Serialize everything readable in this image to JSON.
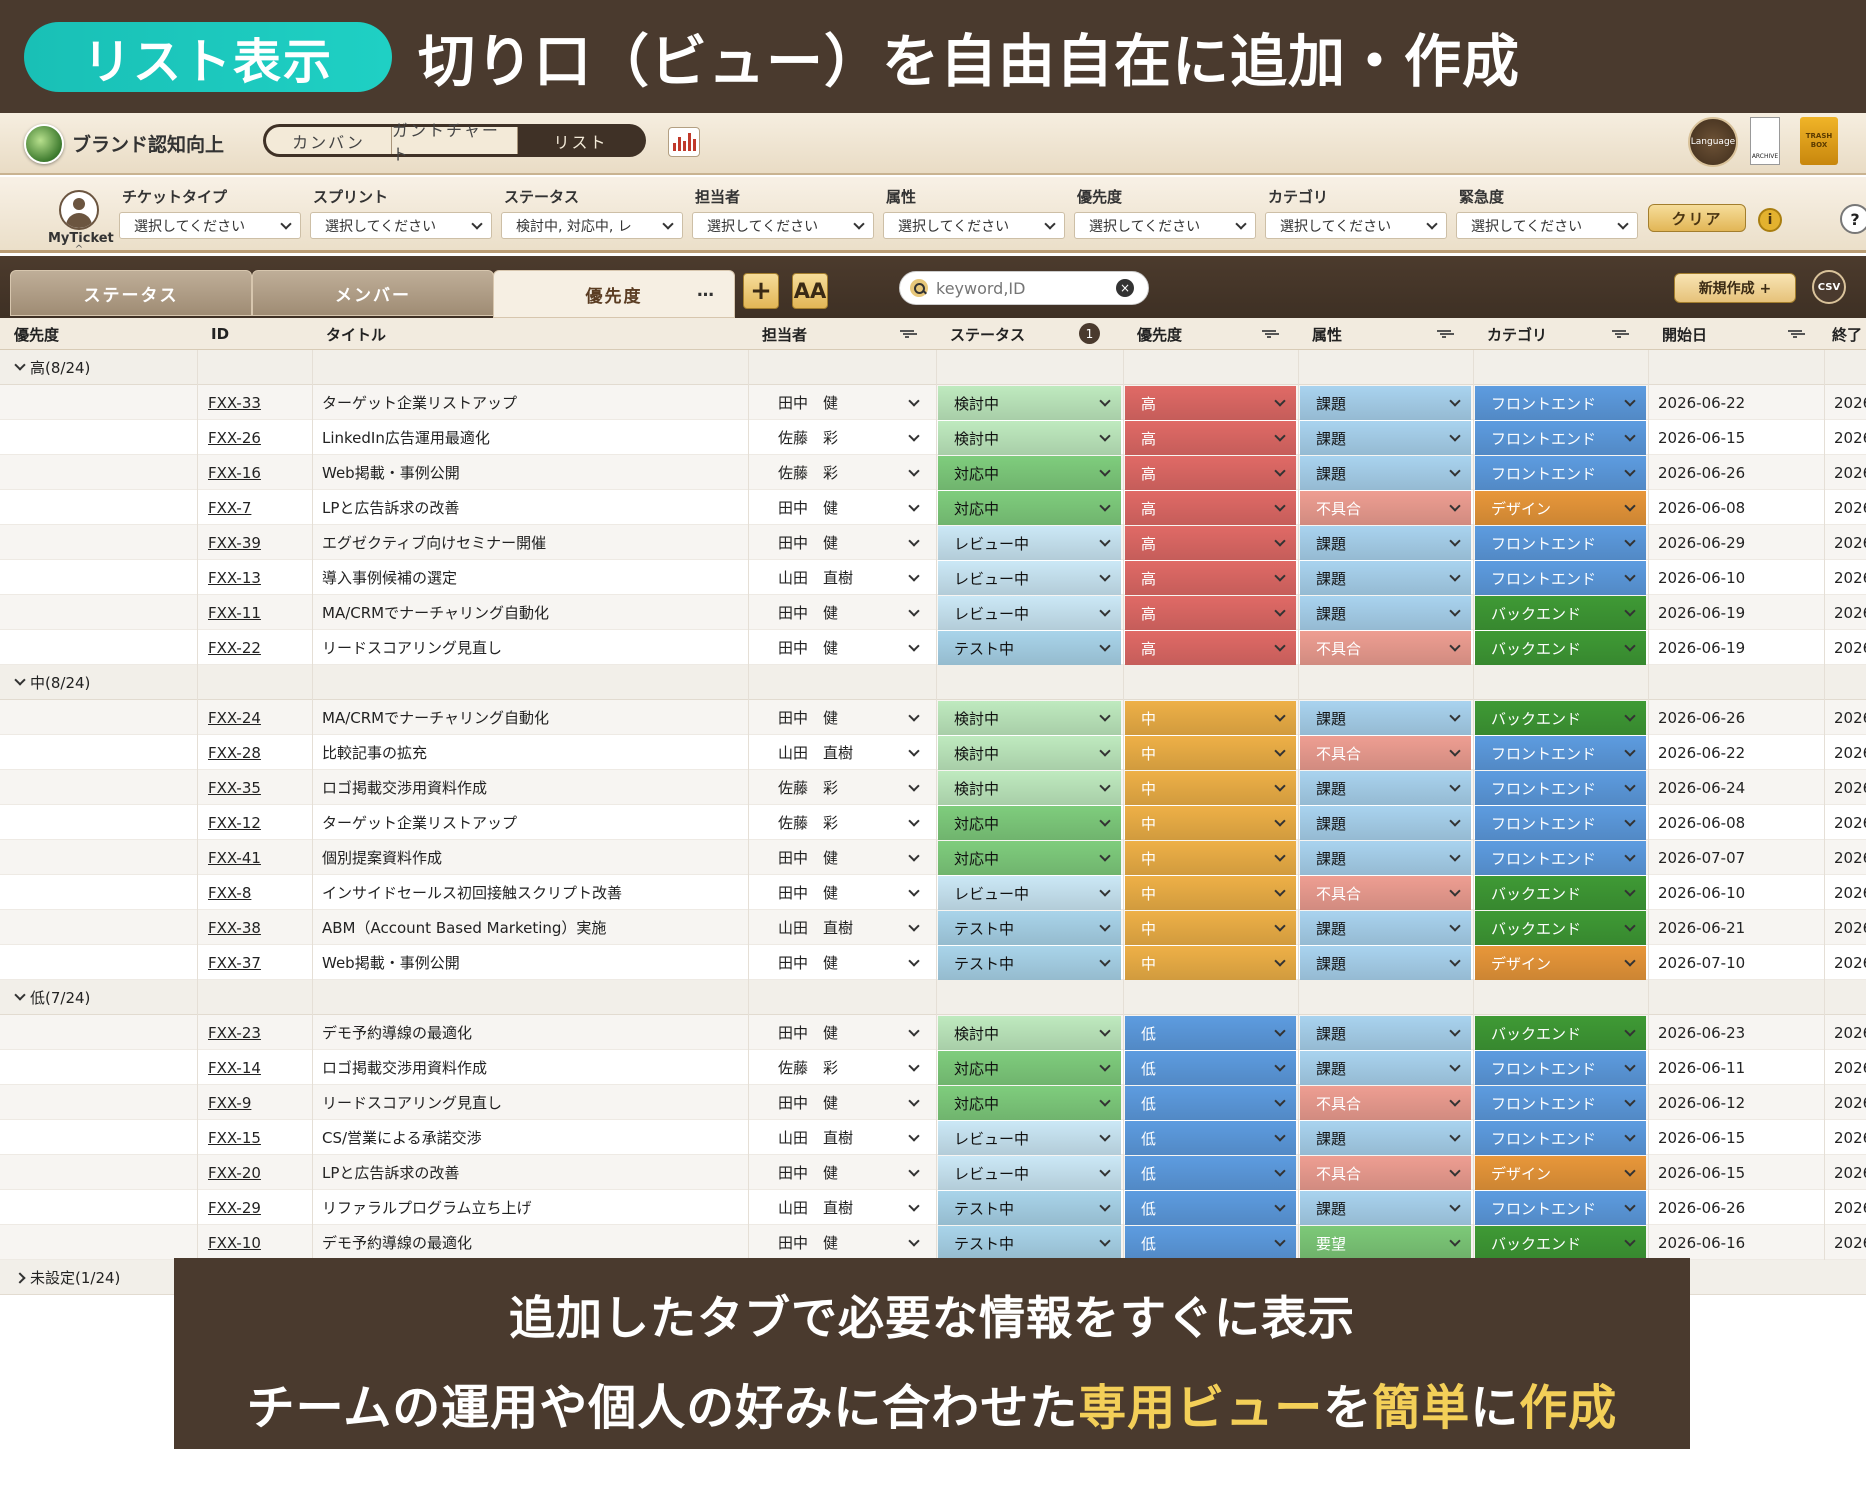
{
  "banner": {
    "badge": "リスト表示",
    "headline": "切り口（ビュー）を自由自在に追加・作成"
  },
  "topbar": {
    "project_name": "ブランド認知向上",
    "view_tabs": [
      {
        "label": "カンバン"
      },
      {
        "label": "ガントチャート"
      },
      {
        "label": "リスト",
        "active": true
      }
    ],
    "language_label": "Language",
    "archive_label": "ARCHIVE",
    "trash_label": "TRASH BOX"
  },
  "filters": {
    "myticket_label": "MyTicket",
    "items": [
      {
        "label": "チケットタイプ",
        "value": "選択してください"
      },
      {
        "label": "スプリント",
        "value": "選択してください"
      },
      {
        "label": "ステータス",
        "value": "検討中, 対応中, レ"
      },
      {
        "label": "担当者",
        "value": "選択してください"
      },
      {
        "label": "属性",
        "value": "選択してください"
      },
      {
        "label": "優先度",
        "value": "選択してください"
      },
      {
        "label": "カテゴリ",
        "value": "選択してください"
      },
      {
        "label": "緊急度",
        "value": "選択してください"
      }
    ],
    "clear_label": "クリア",
    "info_label": "i",
    "help_label": "?"
  },
  "tabs": {
    "items": [
      {
        "label": "ステータス"
      },
      {
        "label": "メンバー"
      },
      {
        "label": "優先度",
        "active": true
      }
    ],
    "more_label": "…",
    "add_label": "+",
    "font_label": "AA",
    "search_placeholder": "keyword,ID",
    "search_clear": "×",
    "new_label": "新規作成 +",
    "csv_label": "CSV"
  },
  "colors": {
    "status": {
      "検討中": "#bfeabf",
      "対応中": "#7fcd7d",
      "レビュー中": "#cbe8f6",
      "テスト中": "#a9d4ea"
    },
    "priority": {
      "高": "#e06a66",
      "中": "#eeb047",
      "低": "#5d9ce0"
    },
    "attribute": {
      "課題": "#a9d3ef",
      "不具合": "#ee9e92",
      "要望": "#7dc978"
    },
    "category": {
      "フロントエンド": "#5d9ce0",
      "デザイン": "#e8973a",
      "バックエンド": "#3f9a35"
    }
  },
  "table": {
    "columns": [
      "優先度",
      "ID",
      "タイトル",
      "担当者",
      "ステータス",
      "優先度",
      "属性",
      "カテゴリ",
      "開始日",
      "終了"
    ],
    "status_badge": "1",
    "groups": [
      {
        "label": "高(8/24)",
        "expanded": true,
        "rows": [
          {
            "id": "FXX-33",
            "title": "ターゲット企業リストアップ",
            "assignee": "田中　健",
            "status": "検討中",
            "priority": "高",
            "attribute": "課題",
            "category": "フロントエンド",
            "start": "2026-06-22",
            "end": "2026"
          },
          {
            "id": "FXX-26",
            "title": "LinkedIn広告運用最適化",
            "assignee": "佐藤　彩",
            "status": "検討中",
            "priority": "高",
            "attribute": "課題",
            "category": "フロントエンド",
            "start": "2026-06-15",
            "end": "2026"
          },
          {
            "id": "FXX-16",
            "title": "Web掲載・事例公開",
            "assignee": "佐藤　彩",
            "status": "対応中",
            "priority": "高",
            "attribute": "課題",
            "category": "フロントエンド",
            "start": "2026-06-26",
            "end": "2026"
          },
          {
            "id": "FXX-7",
            "title": "LPと広告訴求の改善",
            "assignee": "田中　健",
            "status": "対応中",
            "priority": "高",
            "attribute": "不具合",
            "category": "デザイン",
            "start": "2026-06-08",
            "end": "2026"
          },
          {
            "id": "FXX-39",
            "title": "エグゼクティブ向けセミナー開催",
            "assignee": "田中　健",
            "status": "レビュー中",
            "priority": "高",
            "attribute": "課題",
            "category": "フロントエンド",
            "start": "2026-06-29",
            "end": "2026"
          },
          {
            "id": "FXX-13",
            "title": "導入事例候補の選定",
            "assignee": "山田　直樹",
            "status": "レビュー中",
            "priority": "高",
            "attribute": "課題",
            "category": "フロントエンド",
            "start": "2026-06-10",
            "end": "2026"
          },
          {
            "id": "FXX-11",
            "title": "MA/CRMでナーチャリング自動化",
            "assignee": "田中　健",
            "status": "レビュー中",
            "priority": "高",
            "attribute": "課題",
            "category": "バックエンド",
            "start": "2026-06-19",
            "end": "2026"
          },
          {
            "id": "FXX-22",
            "title": "リードスコアリング見直し",
            "assignee": "田中　健",
            "status": "テスト中",
            "priority": "高",
            "attribute": "不具合",
            "category": "バックエンド",
            "start": "2026-06-19",
            "end": "2026"
          }
        ]
      },
      {
        "label": "中(8/24)",
        "expanded": true,
        "rows": [
          {
            "id": "FXX-24",
            "title": "MA/CRMでナーチャリング自動化",
            "assignee": "田中　健",
            "status": "検討中",
            "priority": "中",
            "attribute": "課題",
            "category": "バックエンド",
            "start": "2026-06-26",
            "end": "2026"
          },
          {
            "id": "FXX-28",
            "title": "比較記事の拡充",
            "assignee": "山田　直樹",
            "status": "検討中",
            "priority": "中",
            "attribute": "不具合",
            "category": "フロントエンド",
            "start": "2026-06-22",
            "end": "2026"
          },
          {
            "id": "FXX-35",
            "title": "ロゴ掲載交渉用資料作成",
            "assignee": "佐藤　彩",
            "status": "検討中",
            "priority": "中",
            "attribute": "課題",
            "category": "フロントエンド",
            "start": "2026-06-24",
            "end": "2026"
          },
          {
            "id": "FXX-12",
            "title": "ターゲット企業リストアップ",
            "assignee": "佐藤　彩",
            "status": "対応中",
            "priority": "中",
            "attribute": "課題",
            "category": "フロントエンド",
            "start": "2026-06-08",
            "end": "2026"
          },
          {
            "id": "FXX-41",
            "title": "個別提案資料作成",
            "assignee": "田中　健",
            "status": "対応中",
            "priority": "中",
            "attribute": "課題",
            "category": "フロントエンド",
            "start": "2026-07-07",
            "end": "2026"
          },
          {
            "id": "FXX-8",
            "title": "インサイドセールス初回接触スクリプト改善",
            "assignee": "田中　健",
            "status": "レビュー中",
            "priority": "中",
            "attribute": "不具合",
            "category": "バックエンド",
            "start": "2026-06-10",
            "end": "2026"
          },
          {
            "id": "FXX-38",
            "title": "ABM（Account Based Marketing）実施",
            "assignee": "山田　直樹",
            "status": "テスト中",
            "priority": "中",
            "attribute": "課題",
            "category": "バックエンド",
            "start": "2026-06-21",
            "end": "2026"
          },
          {
            "id": "FXX-37",
            "title": "Web掲載・事例公開",
            "assignee": "田中　健",
            "status": "テスト中",
            "priority": "中",
            "attribute": "課題",
            "category": "デザイン",
            "start": "2026-07-10",
            "end": "2026"
          }
        ]
      },
      {
        "label": "低(7/24)",
        "expanded": true,
        "rows": [
          {
            "id": "FXX-23",
            "title": "デモ予約導線の最適化",
            "assignee": "田中　健",
            "status": "検討中",
            "priority": "低",
            "attribute": "課題",
            "category": "バックエンド",
            "start": "2026-06-23",
            "end": "2026"
          },
          {
            "id": "FXX-14",
            "title": "ロゴ掲載交渉用資料作成",
            "assignee": "佐藤　彩",
            "status": "対応中",
            "priority": "低",
            "attribute": "課題",
            "category": "フロントエンド",
            "start": "2026-06-11",
            "end": "2026"
          },
          {
            "id": "FXX-9",
            "title": "リードスコアリング見直し",
            "assignee": "田中　健",
            "status": "対応中",
            "priority": "低",
            "attribute": "不具合",
            "category": "フロントエンド",
            "start": "2026-06-12",
            "end": "2026"
          },
          {
            "id": "FXX-15",
            "title": "CS/営業による承諾交渉",
            "assignee": "山田　直樹",
            "status": "レビュー中",
            "priority": "低",
            "attribute": "課題",
            "category": "フロントエンド",
            "start": "2026-06-15",
            "end": "2026"
          },
          {
            "id": "FXX-20",
            "title": "LPと広告訴求の改善",
            "assignee": "田中　健",
            "status": "レビュー中",
            "priority": "低",
            "attribute": "不具合",
            "category": "デザイン",
            "start": "2026-06-15",
            "end": "2026"
          },
          {
            "id": "FXX-29",
            "title": "リファラルプログラム立ち上げ",
            "assignee": "山田　直樹",
            "status": "テスト中",
            "priority": "低",
            "attribute": "課題",
            "category": "フロントエンド",
            "start": "2026-06-26",
            "end": "2026"
          },
          {
            "id": "FXX-10",
            "title": "デモ予約導線の最適化",
            "assignee": "田中　健",
            "status": "テスト中",
            "priority": "低",
            "attribute": "要望",
            "category": "バックエンド",
            "start": "2026-06-16",
            "end": "2026"
          }
        ]
      },
      {
        "label": "未設定(1/24)",
        "expanded": false,
        "rows": []
      }
    ]
  },
  "note": {
    "line1": "追加したタブで必要な情報をすぐに表示",
    "line2_parts": [
      {
        "text": "チームの運用や個人の好みに合わせた",
        "hl": false
      },
      {
        "text": "専用ビュー",
        "hl": true
      },
      {
        "text": "を",
        "hl": false
      },
      {
        "text": "簡単",
        "hl": true
      },
      {
        "text": "に",
        "hl": false
      },
      {
        "text": "作成",
        "hl": true
      }
    ]
  }
}
